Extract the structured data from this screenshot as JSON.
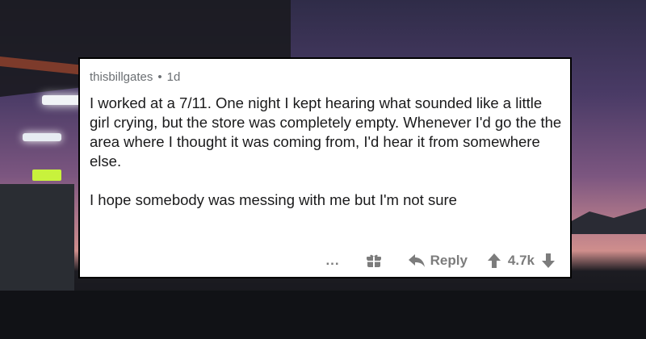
{
  "comment": {
    "username": "thisbillgates",
    "separator": "•",
    "age": "1d",
    "paragraphs": [
      "I worked at a 7/11. One night I kept hearing what sounded like a little girl crying, but the store was completely empty. Whenever I'd go the the area where I thought it was coming from, I'd hear it from somewhere else.",
      "I hope somebody was messing with me but I'm not sure"
    ],
    "actions": {
      "more": "...",
      "reply_label": "Reply",
      "score": "4.7k"
    }
  },
  "icons": {
    "more": "more-options-icon",
    "award": "gift-icon",
    "reply": "reply-arrow-icon",
    "upvote": "upvote-arrow-icon",
    "downvote": "downvote-arrow-icon"
  },
  "colors": {
    "card_bg": "#ffffff",
    "text": "#1a1a1b",
    "meta": "#6b6f73",
    "action": "#7c7c7c"
  }
}
